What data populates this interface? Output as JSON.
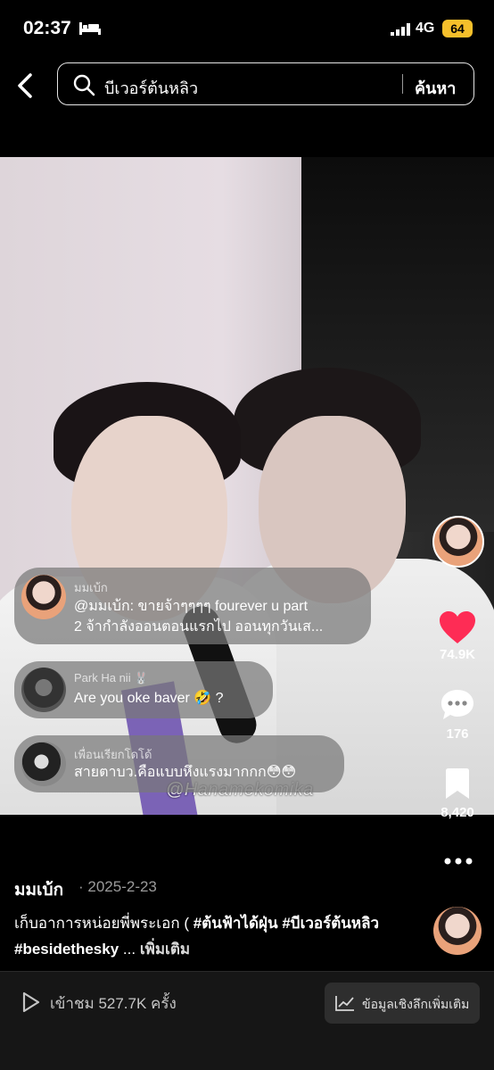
{
  "status_bar": {
    "time": "02:37",
    "network": "4G",
    "battery": "64"
  },
  "search": {
    "query": "บีเวอร์ต้นหลิว",
    "button_label": "ค้นหา"
  },
  "video": {
    "watermark": "@Hanamekomika"
  },
  "comments": [
    {
      "name": "มมเบ้ก",
      "text_line1": "@มมเบ้ก: ขายจ้าๆๆๆๆ fourever u part",
      "text_line2": "2 จ้ากำลังออนตอนแรกไป ออนทุกวันเส..."
    },
    {
      "name": "Park Ha nii 🐰",
      "text": "Are you oke baver 🤣 ?"
    },
    {
      "name": "เพื่อนเรียกโดโด้",
      "text": "สายตาบว.คือแบบหึงแรงมากกก😳😳"
    }
  ],
  "actions": {
    "likes": "74.9K",
    "comments": "176",
    "saves": "8,420",
    "like_color": "#fe2c55"
  },
  "post": {
    "author": "มมเบ้ก",
    "date": "· 2025-2-23",
    "caption_text": "เก็บอาการหน่อยพี่พระเอก ( ",
    "tag1": "#ต้นฟ้าได้ฝุ่น",
    "tag2": "#บีเวอร์ต้นหลิว",
    "tag3": "#besidethesky",
    "ellipsis": " ... ",
    "more_label": "เพิ่มเติม"
  },
  "bottom": {
    "views": "เข้าชม 527.7K ครั้ง",
    "insights_label": "ข้อมูลเชิงลึกเพิ่มเติม"
  }
}
